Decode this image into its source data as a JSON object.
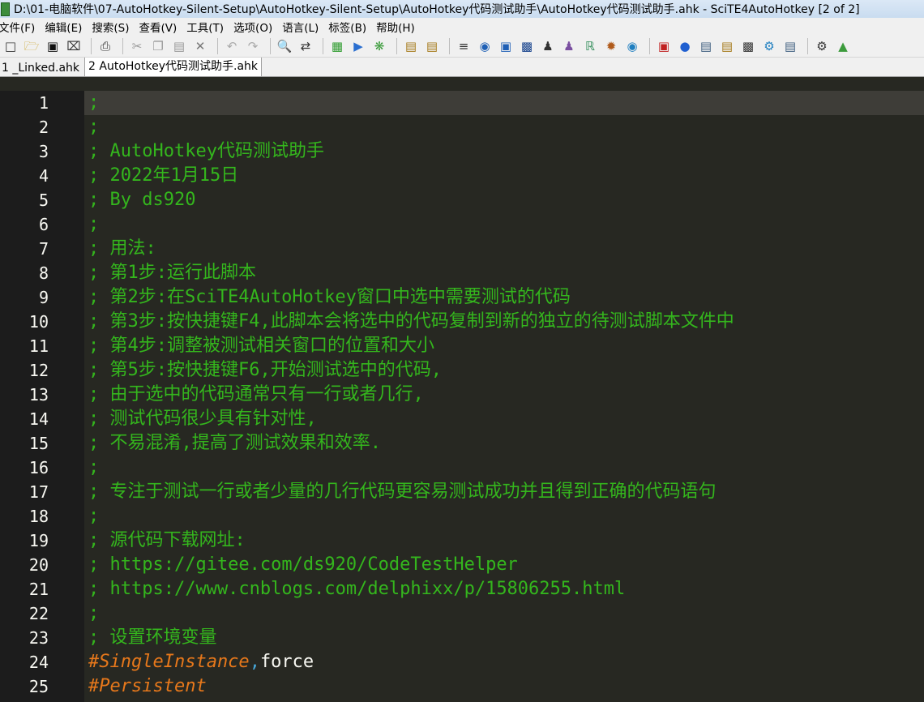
{
  "window": {
    "title": "D:\\01-电脑软件\\07-AutoHotkey-Silent-Setup\\AutoHotkey-Silent-Setup\\AutoHotkey代码测试助手\\AutoHotkey代码测试助手.ahk - SciTE4AutoHotkey [2 of 2]"
  },
  "menu": [
    {
      "label": "文件(F)"
    },
    {
      "label": "编辑(E)"
    },
    {
      "label": "搜索(S)"
    },
    {
      "label": "查看(V)"
    },
    {
      "label": "工具(T)"
    },
    {
      "label": "选项(O)"
    },
    {
      "label": "语言(L)"
    },
    {
      "label": "标签(B)"
    },
    {
      "label": "帮助(H)"
    }
  ],
  "toolbar": {
    "icons": [
      "new-file-icon",
      "open-folder-icon",
      "save-icon",
      "close-file-icon",
      "print-icon",
      "cut-icon",
      "copy-icon",
      "paste-icon",
      "delete-icon",
      "undo-icon",
      "redo-icon",
      "find-icon",
      "replace-icon",
      "compile-icon",
      "run-icon",
      "debug-icon"
    ]
  },
  "tabs": [
    {
      "label": "1 _Linked.ahk",
      "active": false
    },
    {
      "label": "2 AutoHotkey代码测试助手.ahk",
      "active": true
    }
  ],
  "editor": {
    "lines": [
      {
        "n": "1",
        "parts": [
          {
            "t": ";",
            "c": "comment"
          }
        ]
      },
      {
        "n": "2",
        "parts": [
          {
            "t": ";",
            "c": "comment"
          }
        ]
      },
      {
        "n": "3",
        "parts": [
          {
            "t": "; AutoHotkey代码测试助手",
            "c": "comment"
          }
        ]
      },
      {
        "n": "4",
        "parts": [
          {
            "t": "; 2022年1月15日",
            "c": "comment"
          }
        ]
      },
      {
        "n": "5",
        "parts": [
          {
            "t": "; By ds920",
            "c": "comment"
          }
        ]
      },
      {
        "n": "6",
        "parts": [
          {
            "t": ";",
            "c": "comment"
          }
        ]
      },
      {
        "n": "7",
        "parts": [
          {
            "t": "; 用法:",
            "c": "comment"
          }
        ]
      },
      {
        "n": "8",
        "parts": [
          {
            "t": "; 第1步:运行此脚本",
            "c": "comment"
          }
        ]
      },
      {
        "n": "9",
        "parts": [
          {
            "t": "; 第2步:在SciTE4AutoHotkey窗口中选中需要测试的代码",
            "c": "comment"
          }
        ]
      },
      {
        "n": "10",
        "parts": [
          {
            "t": "; 第3步:按快捷键F4,此脚本会将选中的代码复制到新的独立的待测试脚本文件中",
            "c": "comment"
          }
        ]
      },
      {
        "n": "11",
        "parts": [
          {
            "t": "; 第4步:调整被测试相关窗口的位置和大小",
            "c": "comment"
          }
        ]
      },
      {
        "n": "12",
        "parts": [
          {
            "t": "; 第5步:按快捷键F6,开始测试选中的代码,",
            "c": "comment"
          }
        ]
      },
      {
        "n": "13",
        "parts": [
          {
            "t": "; 由于选中的代码通常只有一行或者几行,",
            "c": "comment"
          }
        ]
      },
      {
        "n": "14",
        "parts": [
          {
            "t": "; 测试代码很少具有针对性,",
            "c": "comment"
          }
        ]
      },
      {
        "n": "15",
        "parts": [
          {
            "t": "; 不易混淆,提高了测试效果和效率.",
            "c": "comment"
          }
        ]
      },
      {
        "n": "16",
        "parts": [
          {
            "t": ";",
            "c": "comment"
          }
        ]
      },
      {
        "n": "17",
        "parts": [
          {
            "t": "; 专注于测试一行或者少量的几行代码更容易测试成功并且得到正确的代码语句",
            "c": "comment"
          }
        ]
      },
      {
        "n": "18",
        "parts": [
          {
            "t": ";",
            "c": "comment"
          }
        ]
      },
      {
        "n": "19",
        "parts": [
          {
            "t": "; 源代码下载网址:",
            "c": "comment"
          }
        ]
      },
      {
        "n": "20",
        "parts": [
          {
            "t": "; https://gitee.com/ds920/CodeTestHelper",
            "c": "comment"
          }
        ]
      },
      {
        "n": "21",
        "parts": [
          {
            "t": "; https://www.cnblogs.com/delphixx/p/15806255.html",
            "c": "comment"
          }
        ]
      },
      {
        "n": "22",
        "parts": [
          {
            "t": ";",
            "c": "comment"
          }
        ]
      },
      {
        "n": "23",
        "parts": [
          {
            "t": "; 设置环境变量",
            "c": "comment"
          }
        ]
      },
      {
        "n": "24",
        "parts": [
          {
            "t": "#SingleInstance",
            "c": "directive"
          },
          {
            "t": ",",
            "c": "punct"
          },
          {
            "t": "force",
            "c": "plain"
          }
        ]
      },
      {
        "n": "25",
        "parts": [
          {
            "t": "#Persistent",
            "c": "directive"
          }
        ]
      }
    ]
  }
}
